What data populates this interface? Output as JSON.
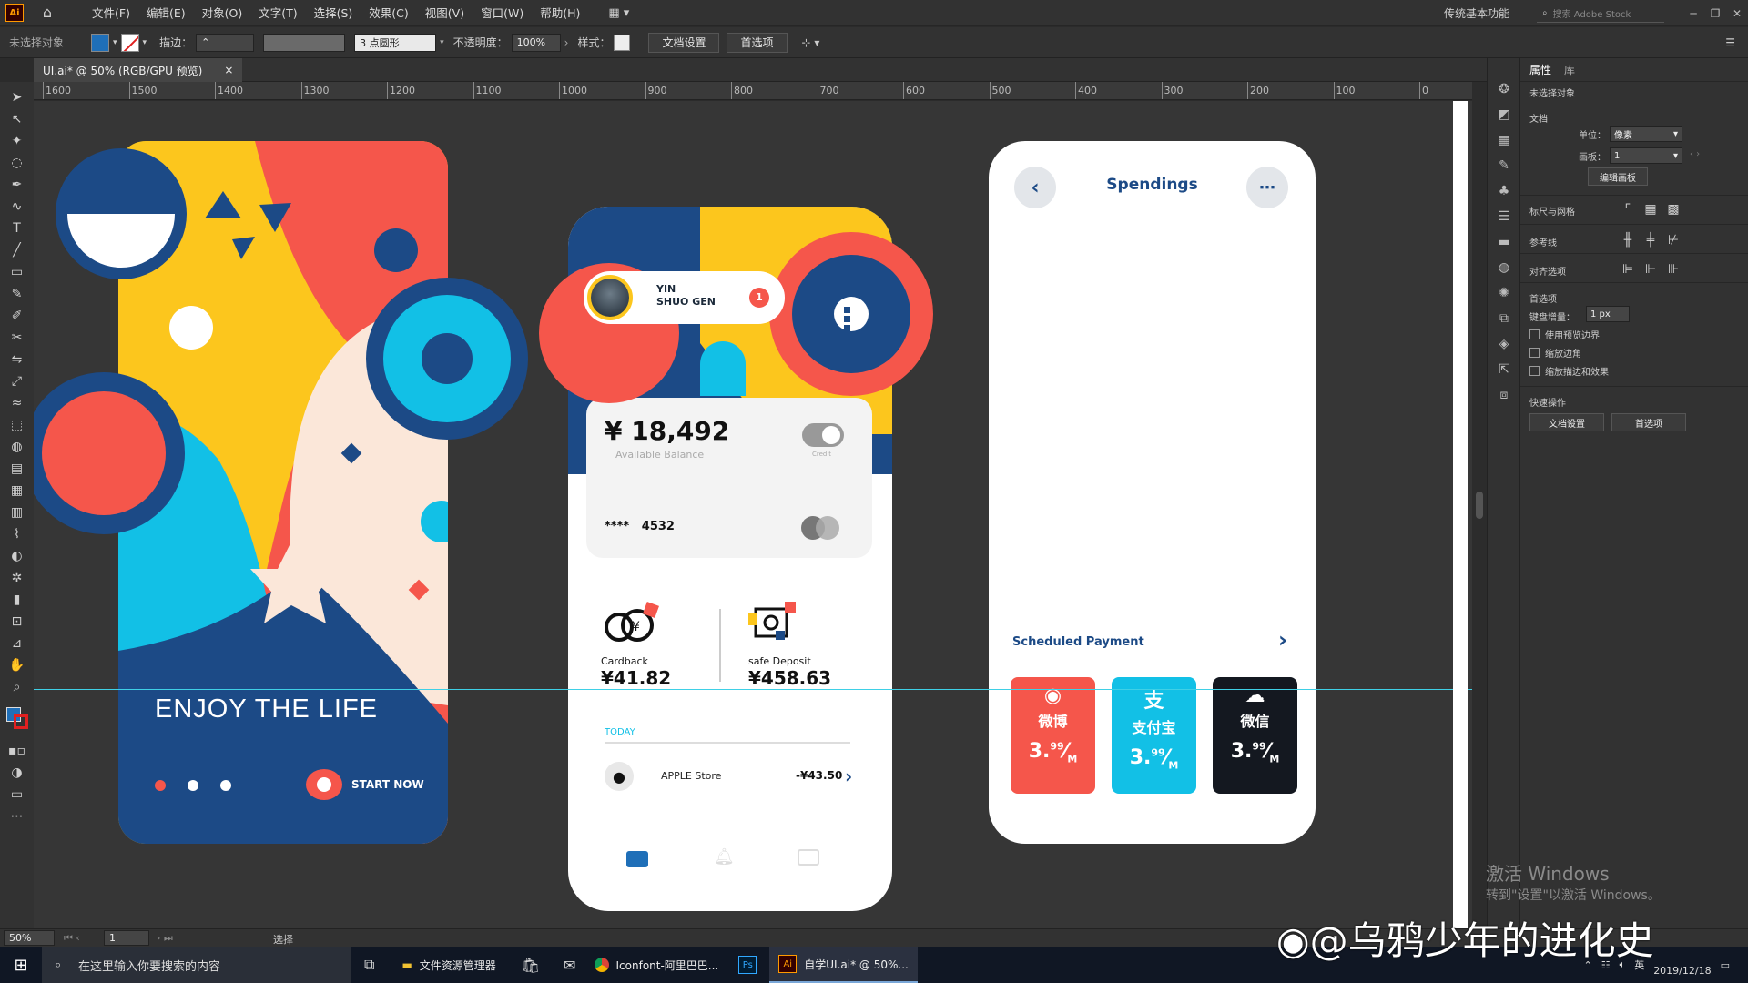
{
  "menubar": {
    "logo": "Ai",
    "items": [
      "文件(F)",
      "编辑(E)",
      "对象(O)",
      "文字(T)",
      "选择(S)",
      "效果(C)",
      "视图(V)",
      "窗口(W)",
      "帮助(H)"
    ],
    "workspace": "传统基本功能",
    "stock_placeholder": "搜索 Adobe Stock"
  },
  "control": {
    "no_selection": "未选择对象",
    "stroke_label": "描边：",
    "brush": "3 点圆形",
    "opacity_label": "不透明度：",
    "opacity": "100%",
    "style_label": "样式：",
    "doc_setup": "文档设置",
    "prefs": "首选项"
  },
  "doc_tab": {
    "title": "UI.ai* @ 50% (RGB/GPU 预览)",
    "close": "×"
  },
  "ruler": [
    "1600",
    "1500",
    "1400",
    "1300",
    "1200",
    "1100",
    "1000",
    "900",
    "800",
    "700",
    "600",
    "500",
    "400",
    "300",
    "200",
    "100",
    "0"
  ],
  "props": {
    "tab_props": "属性",
    "tab_lib": "库",
    "no_selection": "未选择对象",
    "doc": "文档",
    "unit_label": "单位：",
    "unit": "像素",
    "artboard_label": "画板：",
    "artboard": "1",
    "edit_artboard": "编辑画板",
    "rulers_grids": "标尺与网格",
    "guides": "参考线",
    "align": "对齐选项",
    "prefs": "首选项",
    "key_inc_label": "键盘增量：",
    "key_inc": "1 px",
    "opt1": "使用预览边界",
    "opt2": "缩放边角",
    "opt3": "缩放描边和效果",
    "quick": "快速操作",
    "btn_doc": "文档设置",
    "btn_pref": "首选项"
  },
  "status": {
    "zoom": "50%",
    "page": "1",
    "mode": "选择"
  },
  "taskbar": {
    "search": "在这里输入你要搜索的内容",
    "explorer": "文件资源管理器",
    "chrome": "Iconfont-阿里巴巴...",
    "ai": "自学UI.ai* @ 50%...",
    "ime": "英",
    "date": "2019/12/18"
  },
  "activate": {
    "line1": "激活 Windows",
    "line2": "转到\"设置\"以激活 Windows。"
  },
  "watermark": "@乌鸦少年的进化史",
  "art1": {
    "tagline": "ENJOY THE LIFE",
    "start": "START NOW"
  },
  "art2": {
    "user_first": "YIN",
    "user_last": "SHUO GEN",
    "notif": "1",
    "balance": "¥ 18,492",
    "balance_label": "Available Balance",
    "toggle_label": "Credit",
    "card_mask": "****",
    "card_last": "4532",
    "cardback_label": "Cardback",
    "cardback_value": "¥41.82",
    "deposit_label": "safe Deposit",
    "deposit_value": "¥458.63",
    "today": "TODAY",
    "tx_name": "APPLE Store",
    "tx_amount": "-¥43.50"
  },
  "art3": {
    "title": "Spendings",
    "scheduled": "Scheduled Payment",
    "cards": [
      {
        "name": "微博",
        "rate": "3.",
        "sup": "99",
        "unit": "M",
        "color": "#f5564b"
      },
      {
        "name": "支付宝",
        "rate": "3.",
        "sup": "99",
        "unit": "M",
        "color": "#12c0e6"
      },
      {
        "name": "微信",
        "rate": "3.",
        "sup": "99",
        "unit": "M",
        "color": "#141820"
      }
    ]
  },
  "colors": {
    "red": "#f5564b",
    "navy": "#1c4a86",
    "yellow": "#fcc61d",
    "cyan": "#12c0e6",
    "cream": "#fbe7d9"
  }
}
